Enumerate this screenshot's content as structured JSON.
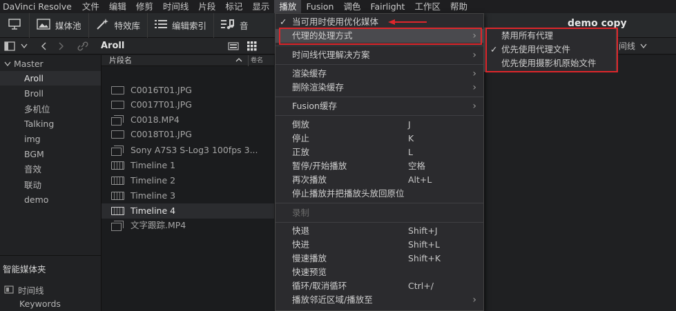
{
  "menubar": {
    "items": [
      "DaVinci Resolve",
      "文件",
      "编辑",
      "修剪",
      "时间线",
      "片段",
      "标记",
      "显示",
      "播放",
      "Fusion",
      "调色",
      "Fairlight",
      "工作区",
      "帮助"
    ],
    "active_index": 8
  },
  "toolbar": {
    "media_pool": "媒体池",
    "effects": "特效库",
    "edit_index": "编辑索引",
    "audio": "音",
    "project_title": "demo copy"
  },
  "toolbar2": {
    "bin_title": "Aroll",
    "right_label": "间线"
  },
  "sidebar": {
    "master": "Master",
    "items": [
      "Aroll",
      "Broll",
      "多机位",
      "Talking",
      "img",
      "BGM",
      "音效",
      "联动",
      "demo"
    ],
    "selected": "Aroll",
    "smart_bins_title": "智能媒体夹",
    "smart_items": [
      "时间线",
      "Keywords"
    ]
  },
  "cliplist": {
    "header_name": "片段名",
    "header_col2": "卷名",
    "rows": [
      {
        "label": "C0016T01.JPG",
        "type": "image"
      },
      {
        "label": "C0017T01.JPG",
        "type": "image"
      },
      {
        "label": "C0018.MP4",
        "type": "video"
      },
      {
        "label": "C0018T01.JPG",
        "type": "image"
      },
      {
        "label": "Sony A7S3 S-Log3 100fps 3...",
        "type": "video"
      },
      {
        "label": "Timeline 1",
        "type": "timeline"
      },
      {
        "label": "Timeline 2",
        "type": "timeline"
      },
      {
        "label": "Timeline 3",
        "type": "timeline"
      },
      {
        "label": "Timeline 4",
        "type": "timeline"
      },
      {
        "label": "文字跟踪.MP4",
        "type": "video"
      }
    ],
    "selected": "Timeline 4"
  },
  "playback_menu": {
    "use_optimized": "当可用时使用优化媒体",
    "proxy_handling": "代理的处理方式",
    "timeline_proxy_res": "时间线代理解决方案",
    "render_cache": "渲染缓存",
    "delete_render_cache": "删除渲染缓存",
    "fusion_cache": "Fusion缓存",
    "reverse": "倒放",
    "reverse_sc": "J",
    "stop": "停止",
    "stop_sc": "K",
    "forward": "正放",
    "forward_sc": "L",
    "play_pause": "暂停/开始播放",
    "play_pause_sc": "空格",
    "play_again": "再次播放",
    "play_again_sc": "Alt+L",
    "stop_return": "停止播放并把播放头放回原位",
    "record": "录制",
    "fast_reverse": "快退",
    "fast_reverse_sc": "Shift+J",
    "fast_forward": "快进",
    "fast_forward_sc": "Shift+L",
    "slow_play": "慢速播放",
    "slow_play_sc": "Shift+K",
    "fast_preview": "快速预览",
    "loop": "循环/取消循环",
    "loop_sc": "Ctrl+/",
    "play_around": "播放邻近区域/播放至"
  },
  "proxy_submenu": {
    "disable_all": "禁用所有代理",
    "prefer_proxy": "优先使用代理文件",
    "prefer_camera": "优先使用摄影机原始文件",
    "checked": "prefer_proxy"
  },
  "colors": {
    "annotation_red": "#e0262b",
    "menu_bg": "#2b2b2e",
    "highlight": "#4a4a4e"
  }
}
